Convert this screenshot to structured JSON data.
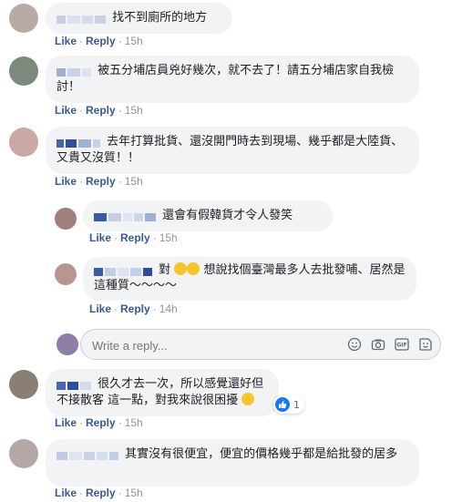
{
  "comments": [
    {
      "text": "找不到廁所的地方",
      "like": "Like",
      "reply": "Reply",
      "time": "15h"
    },
    {
      "text": "被五分埔店員兇好幾次，就不去了！請五分埔店家自我檢討！",
      "like": "Like",
      "reply": "Reply",
      "time": "15h"
    },
    {
      "text": "去年打算批貨、還沒開門時去到現場、幾乎都是大陸貨、又貴又沒質！！",
      "like": "Like",
      "reply": "Reply",
      "time": "15h"
    },
    {
      "text": "還會有假韓貨才令人發笑",
      "like": "Like",
      "reply": "Reply",
      "time": "15h"
    },
    {
      "text_before": "對",
      "text_after": "想說找個臺灣最多人去批發哺、居然是這種質～～～～",
      "like": "Like",
      "reply": "Reply",
      "time": "14h"
    },
    {
      "text": "很久才去一次，所以感覺還好但 不接散客 這一點，對我來說很困擾",
      "reaction_count": "1",
      "like": "Like",
      "reply": "Reply",
      "time": "15h"
    },
    {
      "text": "其實沒有很便宜，便宜的價格幾乎都是給批發的居多",
      "like": "Like",
      "reply": "Reply",
      "time": "15h"
    }
  ],
  "reply_box": {
    "placeholder": "Write a reply...",
    "icons": [
      "emoji-icon",
      "camera-icon",
      "gif-icon",
      "sticker-icon"
    ]
  },
  "colors": {
    "bubble": "#f2f3f5",
    "link": "#385898",
    "time": "#90949c",
    "like_blue": "#1877f2"
  }
}
